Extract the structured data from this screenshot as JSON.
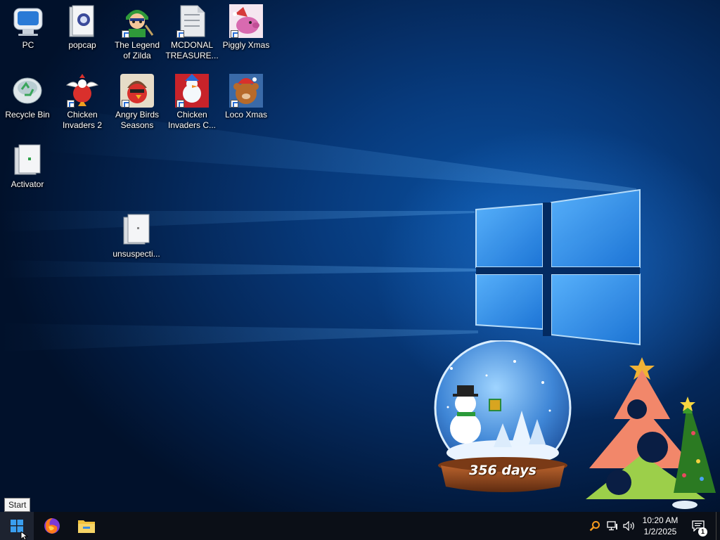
{
  "desktop": {
    "icons": [
      {
        "label": "PC",
        "icon": "monitor-icon"
      },
      {
        "label": "popcap",
        "icon": "folder-icon"
      },
      {
        "label": "The Legend of Zilda",
        "icon": "legend-of-zilda-icon"
      },
      {
        "label": "MCDONAL TREASURE...",
        "icon": "binary-file-icon"
      },
      {
        "label": "Piggly Xmas",
        "icon": "piggly-xmas-icon"
      },
      {
        "label": "Recycle Bin",
        "icon": "recycle-bin-icon"
      },
      {
        "label": "Chicken Invaders 2",
        "icon": "chicken-invaders-2-icon"
      },
      {
        "label": "Angry Birds Seasons",
        "icon": "angry-birds-seasons-icon"
      },
      {
        "label": "Chicken Invaders C...",
        "icon": "chicken-invaders-c-icon"
      },
      {
        "label": "Loco Xmas",
        "icon": "loco-xmas-icon"
      },
      {
        "label": "Activator",
        "icon": "blank-file-icon"
      },
      {
        "label": "unsuspecti...",
        "icon": "blank-file-icon"
      }
    ],
    "snow_globe": {
      "countdown_text": "356 days"
    }
  },
  "tooltip": {
    "text": "Start"
  },
  "taskbar": {
    "start": {
      "icon": "windows-logo-icon"
    },
    "pinned": [
      {
        "name": "Firefox",
        "icon": "firefox-icon"
      },
      {
        "name": "File Explorer",
        "icon": "file-explorer-icon"
      }
    ],
    "tray": {
      "icons": [
        "search-icon",
        "network-icon",
        "speaker-icon",
        "action-center-icon"
      ],
      "time": "10:20 AM",
      "date": "1/2/2025",
      "notifications": "1"
    }
  },
  "colors": {
    "accent": "#2f8fe6",
    "taskbar": "#0b0f17",
    "wallpaper": "#073a7c"
  }
}
